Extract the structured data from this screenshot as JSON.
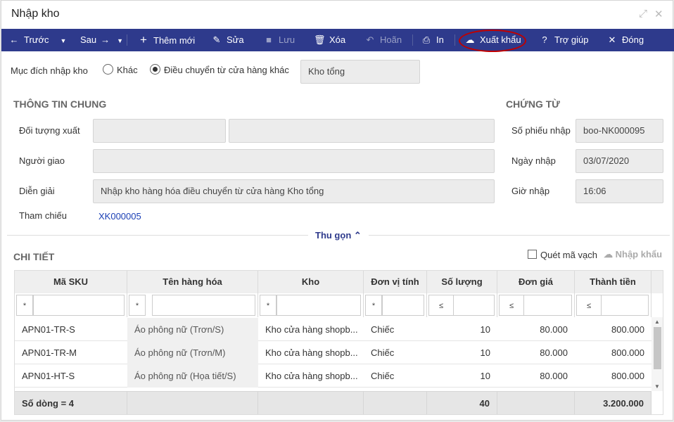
{
  "window": {
    "title": "Nhập kho"
  },
  "toolbar": {
    "prev": "Trước",
    "next": "Sau",
    "add": "Thêm mới",
    "edit": "Sửa",
    "save": "Lưu",
    "delete": "Xóa",
    "undo": "Hoãn",
    "print": "In",
    "export": "Xuất khẩu",
    "help": "Trợ giúp",
    "close": "Đóng"
  },
  "purpose": {
    "label": "Mục đích nhập kho",
    "option_other": "Khác",
    "option_transfer": "Điều chuyển từ cửa hàng khác",
    "selected": "option_transfer",
    "store_value": "Kho tổng"
  },
  "general": {
    "title": "THÔNG TIN CHUNG",
    "target_label": "Đối tượng xuất",
    "target_code": "",
    "target_name": "",
    "deliverer_label": "Người giao",
    "deliverer": "",
    "desc_label": "Diễn giải",
    "desc": "Nhập kho hàng hóa điều chuyển từ cửa hàng Kho tổng",
    "ref_label": "Tham chiếu",
    "ref": "XK000005"
  },
  "voucher": {
    "title": "CHỨNG TỪ",
    "no_label": "Số phiếu nhập",
    "no": "boo-NK000095",
    "date_label": "Ngày nhập",
    "date": "03/07/2020",
    "time_label": "Giờ nhập",
    "time": "16:06"
  },
  "collapse_label": "Thu gọn",
  "detail": {
    "title": "CHI TIẾT",
    "scan_label": "Quét mã vạch",
    "import_label": "Nhập khẩu",
    "columns": [
      "Mã SKU",
      "Tên hàng hóa",
      "Kho",
      "Đơn vị tính",
      "Số lượng",
      "Đơn giá",
      "Thành tiền"
    ],
    "filter_ops": [
      "*",
      "*",
      "*",
      "*",
      "≤",
      "≤",
      "≤"
    ],
    "rows": [
      [
        "APN01-TR-S",
        "Áo phông nữ (Trơn/S)",
        "Kho cửa hàng shopb...",
        "Chiếc",
        "10",
        "80.000",
        "800.000"
      ],
      [
        "APN01-TR-M",
        "Áo phông nữ (Trơn/M)",
        "Kho cửa hàng shopb...",
        "Chiếc",
        "10",
        "80.000",
        "800.000"
      ],
      [
        "APN01-HT-S",
        "Áo phông nữ (Họa tiết/S)",
        "Kho cửa hàng shopb...",
        "Chiếc",
        "10",
        "80.000",
        "800.000"
      ]
    ],
    "footer": {
      "count_label": "Số dòng = 4",
      "qty_total": "40",
      "amount_total": "3.200.000"
    }
  },
  "colors": {
    "toolbar": "#2e3a8c",
    "link": "#1a3fb5",
    "highlight_ring": "#c00000"
  }
}
